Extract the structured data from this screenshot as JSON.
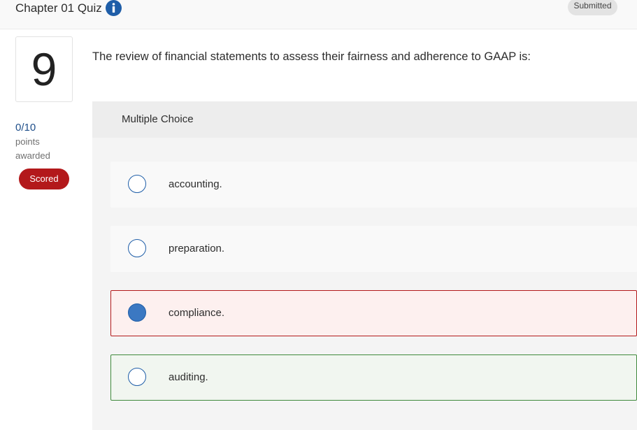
{
  "header": {
    "title": "Chapter 01 Quiz",
    "info_icon": "info-icon",
    "status": "Submitted"
  },
  "question": {
    "number": "9",
    "score": "0/10",
    "score_label_1": "points",
    "score_label_2": "awarded",
    "scored_badge": "Scored",
    "text": "The review of financial statements to assess their fairness and adherence to GAAP is:"
  },
  "answer_section": {
    "type_label": "Multiple Choice",
    "options": [
      {
        "label": "accounting.",
        "selected": false,
        "state": "neutral"
      },
      {
        "label": "preparation.",
        "selected": false,
        "state": "neutral"
      },
      {
        "label": "compliance.",
        "selected": true,
        "state": "incorrect"
      },
      {
        "label": "auditing.",
        "selected": false,
        "state": "correct"
      }
    ]
  },
  "colors": {
    "accent_blue": "#1f5ea8",
    "scored_red": "#b3191b",
    "incorrect_border": "#b3191b",
    "correct_border": "#3f8a3c"
  }
}
